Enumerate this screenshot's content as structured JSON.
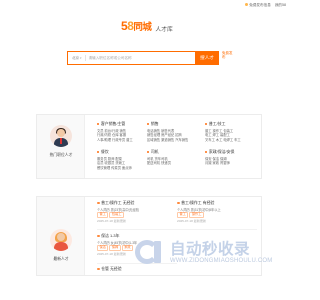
{
  "topbar": {
    "links": [
      "免费发布信息",
      "我的58"
    ]
  },
  "brand": {
    "logo_num_1": "5",
    "logo_num_2": "8",
    "logo_text": "同城",
    "subtitle": "人才库"
  },
  "search": {
    "city": "北京",
    "placeholder": "请输入职位名称或公司名称",
    "button": "搜人才",
    "publish": "免费发布"
  },
  "hot_section": {
    "label": "热门职位人才",
    "categories": [
      {
        "title": "客户销售/主管",
        "lines": [
          "文员 前台/行政 销售",
          "行政/内勤 仓库 客服",
          "人事/助理 行政专员 普工"
        ]
      },
      {
        "title": "销售",
        "lines": [
          "电话销售 销售代表",
          "销售经理 房产经纪 招商",
          "区域销售 渠道销售 汽车销售"
        ]
      },
      {
        "title": "普工/技工",
        "lines": [
          "普工 操作工 包装工",
          "电工 焊工 装配工",
          "叉车工 木工 电焊工 车工"
        ]
      },
      {
        "title": "餐饮",
        "lines": [
          "服务员 厨师 配菜",
          "店员 收银员 洗碗工",
          "餐饮管理 传菜员 面点师"
        ]
      },
      {
        "title": "司机",
        "lines": [
          "司机 货车司机",
          "配送司机 快递员"
        ]
      },
      {
        "title": "家政/保洁/安保",
        "lines": [
          "保安 保洁 保姆",
          "月嫂 家政 育婴师"
        ]
      }
    ]
  },
  "latest_section": {
    "label": "最新人才",
    "people": [
      {
        "name": "普工/操作工 无经验",
        "row1": "个人简历 男|23岁|高中|无经验",
        "tags": [
          "普工",
          "包装工"
        ],
        "date": "2025-07-18 最新更新"
      },
      {
        "name": "普工/操作工 有经验",
        "row1": "个人简历 男|31岁|初中|5年以上",
        "tags": [
          "普工",
          "操作工"
        ],
        "date": "2025-07-18 最新更新"
      },
      {
        "name": "保洁 1-3年",
        "row1": "个人简历 女|45岁|初中|1-3年",
        "tags": [
          "保洁",
          "保姆",
          "家政"
        ],
        "date": "2025-07-18 最新更新"
      },
      {
        "name": "仓管 无经验",
        "row1": "",
        "tags": [],
        "date": ""
      }
    ]
  },
  "watermark": {
    "big": "自动秒收录",
    "small": "WWW.ZIDONGMIAOSHOULU.COM"
  }
}
